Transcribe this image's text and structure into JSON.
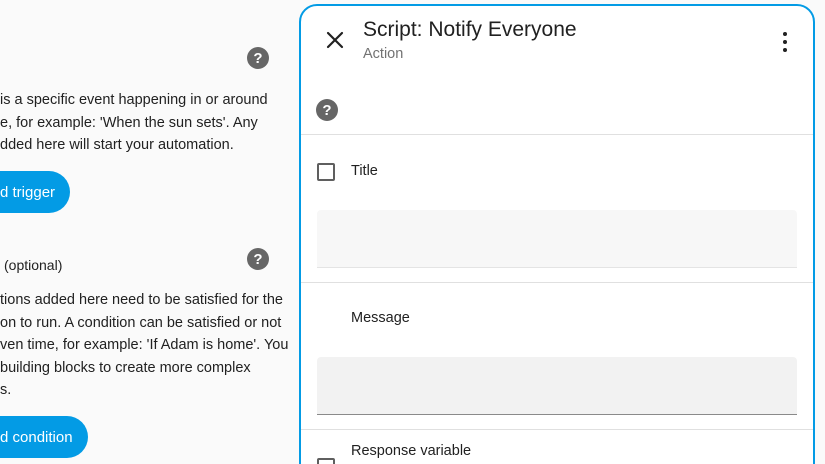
{
  "background": {
    "triggers": {
      "description_lines": [
        "is a specific event happening in or around",
        "e, for example: 'When the sun sets'. Any",
        "dded here will start your automation."
      ],
      "add_button_label": "d trigger"
    },
    "conditions": {
      "heading": "(optional)",
      "description_lines": [
        "tions added here need to be satisfied for the",
        "on to run. A condition can be satisfied or not",
        "ven time, for example: 'If Adam is home'. You",
        "building blocks to create more complex",
        "s."
      ],
      "add_button_label": "d condition"
    },
    "help_glyph": "?"
  },
  "dialog": {
    "title": "Script: Notify Everyone",
    "subtitle": "Action",
    "close_glyph": "✕",
    "help_glyph": "?",
    "fields": {
      "title_label": "Title",
      "title_value": "",
      "message_label": "Message",
      "message_value": "",
      "response_variable_label": "Response variable"
    }
  },
  "colors": {
    "accent": "#039be5",
    "help_icon": "#666666",
    "field_bg": "#f5f5f5"
  }
}
